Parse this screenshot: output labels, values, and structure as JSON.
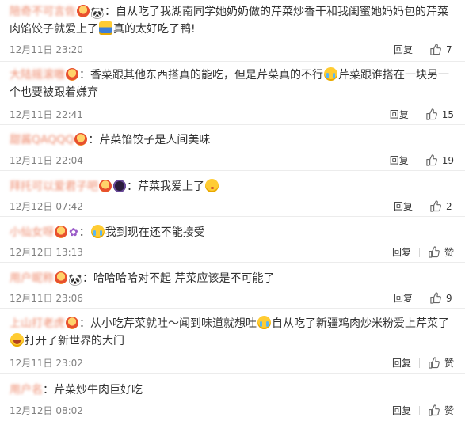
{
  "comments": [
    {
      "user": "陪奇不可言佐",
      "text": "自从吃了我湖南同学她奶奶做的芹菜炒香干和我闺蜜她妈妈包的芹菜肉馅饺子就爱上了",
      "text2": "真的太好吃了鸭!",
      "time": "12月11日 23:20",
      "reply": "回复",
      "likes": "7"
    },
    {
      "user": "大陆摇滚嗷",
      "text": "香菜跟其他东西搭真的能吃，但是芹菜真的不行",
      "text2": "芹菜跟谁搭在一块另一个也要被跟着嫌弃",
      "time": "12月11日 22:41",
      "reply": "回复",
      "likes": "15"
    },
    {
      "user": "甜酱QAQQQ",
      "text": "芹菜馅饺子是人间美味",
      "time": "12月11日 22:04",
      "reply": "回复",
      "likes": "19"
    },
    {
      "user": "拜托可以爱君子吧",
      "text": "芹菜我爱上了",
      "time": "12月12日 07:42",
      "reply": "回复",
      "likes": "2"
    },
    {
      "user": "小仙女呀",
      "text": "我到现在还不能接受",
      "time": "12月12日 13:13",
      "reply": "回复",
      "likes": "赞"
    },
    {
      "user": "用户昵称",
      "text": "哈哈哈哈对不起 芹菜应该是不可能了",
      "time": "12月11日 23:06",
      "reply": "回复",
      "likes": "9"
    },
    {
      "user": "上山打老虎",
      "text": "从小吃芹菜就吐～闻到味道就想吐",
      "text_b": "自从吃了新疆鸡肉炒米粉爱",
      "text2": "上芹菜了",
      "text2b": "打开了新世界的大门",
      "time": "12月11日 23:02",
      "reply": "回复",
      "likes": "赞"
    },
    {
      "user": "用户名",
      "text": "芹菜炒牛肉巨好吃",
      "time": "12月12日 08:02",
      "reply": "回复",
      "likes": "赞"
    }
  ],
  "colors": {
    "username": "#eb7350",
    "meta": "#808080",
    "text": "#333333"
  },
  "icons": {
    "like": "thumbs-up-icon",
    "vip": "crown-badge-icon"
  }
}
